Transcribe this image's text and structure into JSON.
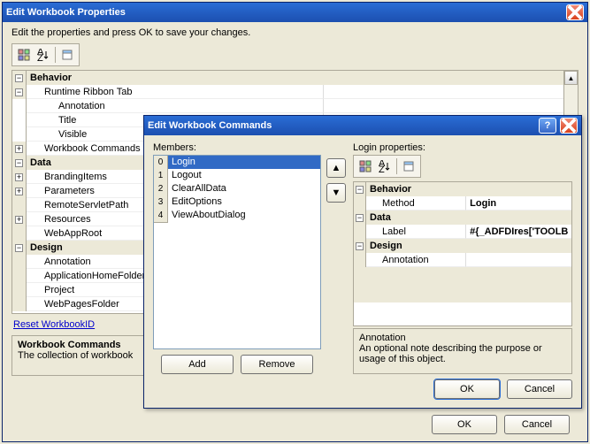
{
  "parent": {
    "title": "Edit Workbook Properties",
    "instruction": "Edit the properties and press OK to save your changes.",
    "link": "Reset WorkbookID",
    "desc_title": "Workbook Commands",
    "desc_body": "The collection of workbook",
    "ok": "OK",
    "cancel": "Cancel",
    "categories": {
      "behavior": "Behavior",
      "data": "Data",
      "design": "Design"
    },
    "rows": {
      "runtime_ribbon": "Runtime Ribbon Tab",
      "annotation": "Annotation",
      "title": "Title",
      "visible": "Visible",
      "workbook_commands": "Workbook Commands",
      "branding": "BrandingItems",
      "parameters": "Parameters",
      "remote": "RemoteServletPath",
      "resources": "Resources",
      "webapproot": "WebAppRoot",
      "app_home": "ApplicationHomeFolder",
      "project": "Project",
      "webpages": "WebPagesFolder"
    }
  },
  "inner": {
    "title": "Edit Workbook Commands",
    "members_label": "Members:",
    "props_label": "Login properties:",
    "list": [
      "Login",
      "Logout",
      "ClearAllData",
      "EditOptions",
      "ViewAboutDialog"
    ],
    "add": "Add",
    "remove": "Remove",
    "ok": "OK",
    "cancel": "Cancel",
    "grid_cats": {
      "behavior": "Behavior",
      "data": "Data",
      "design": "Design"
    },
    "grid_rows": {
      "method_lbl": "Method",
      "method_val": "Login",
      "label_lbl": "Label",
      "label_val": "#{_ADFDIres['TOOLB",
      "anno_lbl": "Annotation",
      "anno_val": ""
    },
    "desc_title": "Annotation",
    "desc_body": "An optional note describing the purpose or usage of this object."
  }
}
